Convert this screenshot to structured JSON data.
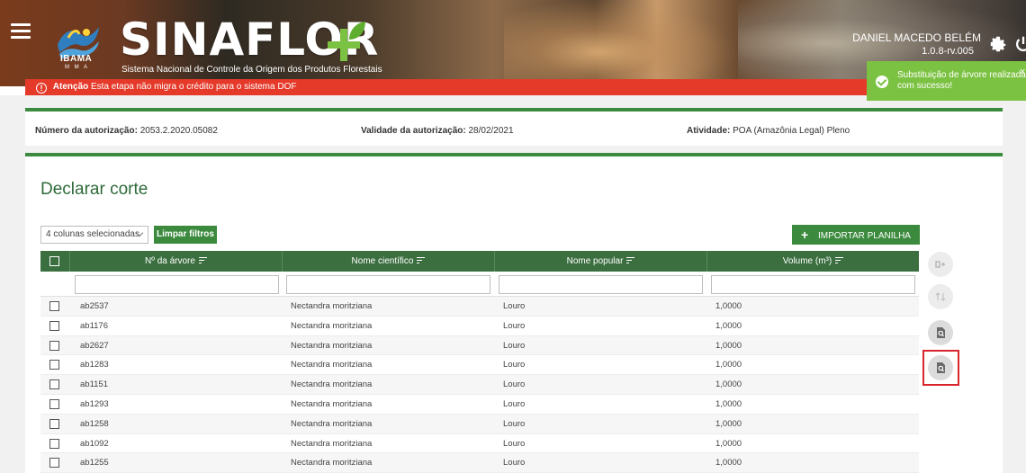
{
  "header": {
    "brand": "SINAFLOR",
    "tagline": "Sistema Nacional de Controle da Origem dos Produtos Florestais",
    "ibama_text": "IBAMA",
    "ibama_sub": "M M A",
    "user_name": "DANIEL MACEDO BELÉM",
    "version": "1.0.8-rv.005",
    "icons": {
      "menu": "hamburger-menu-icon",
      "settings": "gear-icon",
      "logout": "power-icon",
      "logo": "ibama-logo",
      "leaf": "leaf-icon"
    }
  },
  "warning": {
    "label": "Atenção",
    "message": "Esta etapa não migra o crédito para o sistema DOF"
  },
  "toast": {
    "message": "Substituição de árvore realizada com sucesso!",
    "close": "×"
  },
  "authorization": {
    "numero_label": "Número da autorização:",
    "numero_value": "2053.2.2020.05082",
    "validade_label": "Validade da autorização:",
    "validade_value": "28/02/2021",
    "atividade_label": "Atividade:",
    "atividade_value": "POA (Amazônia Legal) Pleno"
  },
  "page": {
    "title": "Declarar corte"
  },
  "toolbar": {
    "columns_selected": "4 colunas selecionadas",
    "clear_filters": "Limpar filtros",
    "import_plus": "+",
    "import_label": "IMPORTAR PLANILHA"
  },
  "table": {
    "columns": [
      "Nº da árvore",
      "Nome científico",
      "Nome popular",
      "Volume (m³)"
    ],
    "rows": [
      [
        "ab2537",
        "Nectandra moritziana",
        "Louro",
        "1,0000"
      ],
      [
        "ab1176",
        "Nectandra moritziana",
        "Louro",
        "1,0000"
      ],
      [
        "ab2627",
        "Nectandra moritziana",
        "Louro",
        "1,0000"
      ],
      [
        "ab1283",
        "Nectandra moritziana",
        "Louro",
        "1,0000"
      ],
      [
        "ab1151",
        "Nectandra moritziana",
        "Louro",
        "1,0000"
      ],
      [
        "ab1293",
        "Nectandra moritziana",
        "Louro",
        "1,0000"
      ],
      [
        "ab1258",
        "Nectandra moritziana",
        "Louro",
        "1,0000"
      ],
      [
        "ab1092",
        "Nectandra moritziana",
        "Louro",
        "1,0000"
      ],
      [
        "ab1255",
        "Nectandra moritziana",
        "Louro",
        "1,0000"
      ]
    ]
  },
  "side_actions": [
    {
      "icon": "tree-add-icon"
    },
    {
      "icon": "swap-icon"
    },
    {
      "icon": "document-search-icon"
    },
    {
      "icon": "document-search-icon"
    }
  ],
  "colors": {
    "primary_green": "#3b8a3e",
    "table_header": "#3b6f3f",
    "warning_red": "#e53a2a",
    "toast_green": "#7cc242",
    "highlight_red": "#d9262e"
  }
}
